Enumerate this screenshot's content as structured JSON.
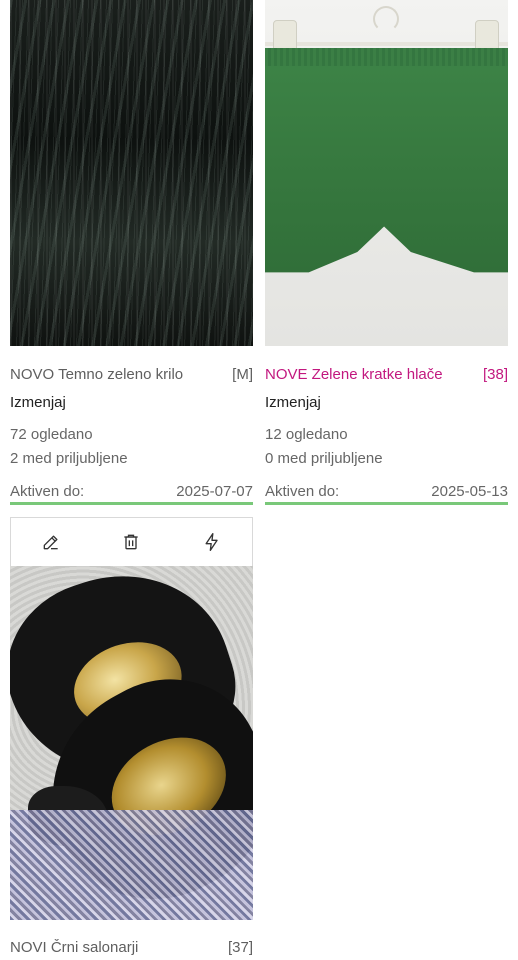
{
  "listings": [
    {
      "title": "NOVO Temno zeleno krilo",
      "size": "[M]",
      "edit_label": "Izmenjaj",
      "views": "72 ogledano",
      "favorites": "2 med priljubljene",
      "active_label": "Aktiven do:",
      "active_date": "2025-07-07",
      "image": "dark green velvet pleated skirt"
    },
    {
      "title": "NOVE Zelene kratke hlače",
      "size": "[38]",
      "edit_label": "Izmenjaj",
      "views": "12 ogledano",
      "favorites": "0 med priljubljene",
      "active_label": "Aktiven do:",
      "active_date": "2025-05-13",
      "image": "green shorts on hanger",
      "highlight_color": "#c2187f"
    },
    {
      "title": "NOVI Črni salonarji",
      "size": "[37]",
      "image": "black suede pumps with gold insole",
      "toolbar_icons": [
        "edit-icon",
        "trash-icon",
        "bolt-icon"
      ]
    }
  ],
  "colors": {
    "active_underline": "#79c879",
    "text_muted": "#666666"
  }
}
